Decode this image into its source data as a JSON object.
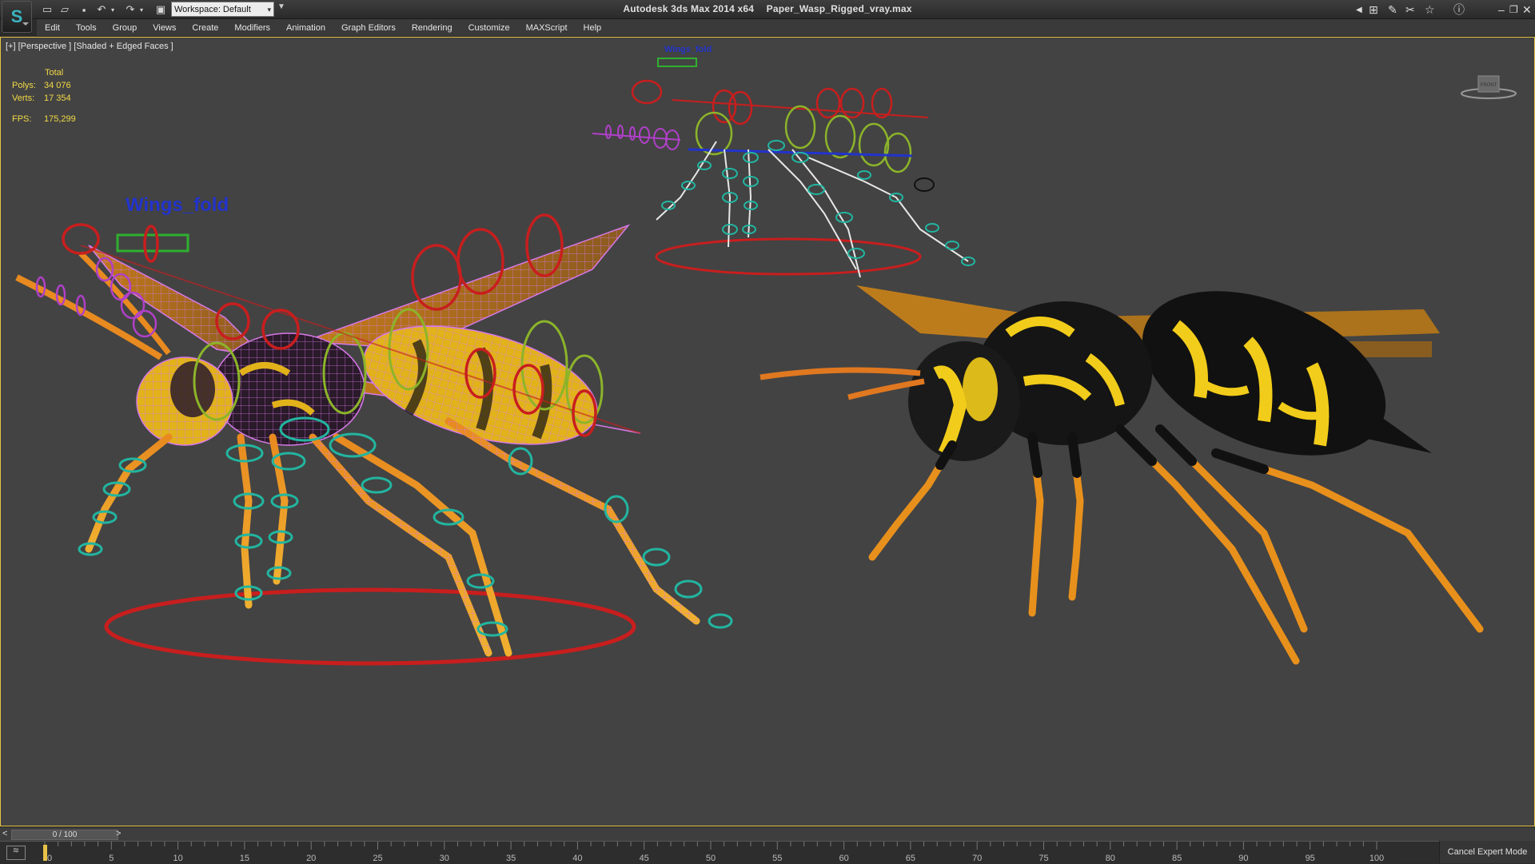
{
  "titlebar": {
    "app_title": "Autodesk 3ds Max  2014 x64",
    "file_name": "Paper_Wasp_Rigged_vray.max",
    "workspace_value": "Workspace: Default",
    "icons": [
      "new-file-icon",
      "open-file-icon",
      "save-icon",
      "undo-icon",
      "redo-icon",
      "project-folder-icon",
      "search-binoculars-icon",
      "tools-icon",
      "snap-icon",
      "star-icon",
      "help-icon",
      "minimize-icon",
      "restore-icon",
      "close-icon"
    ]
  },
  "menu": [
    "Edit",
    "Tools",
    "Group",
    "Views",
    "Create",
    "Modifiers",
    "Animation",
    "Graph Editors",
    "Rendering",
    "Customize",
    "MAXScript",
    "Help"
  ],
  "viewport": {
    "label": "[+] [Perspective ] [Shaded + Edged Faces ]",
    "stats": {
      "header": "Total",
      "polys_label": "Polys:",
      "polys_value": "34 076",
      "verts_label": "Verts:",
      "verts_value": "17 354",
      "fps_label": "FPS:",
      "fps_value": "175,299"
    },
    "rig_label_large": "Wings_fold",
    "rig_label_small": "Wings_fold",
    "viewcube_label": "FRONT"
  },
  "timeslider": {
    "value": "0 / 100",
    "prev": "<",
    "next": ">"
  },
  "timeline": {
    "ticks": [
      "0",
      "5",
      "10",
      "15",
      "20",
      "25",
      "30",
      "35",
      "40",
      "45",
      "50",
      "55",
      "60",
      "65",
      "70",
      "75",
      "80",
      "85",
      "90",
      "95",
      "100"
    ]
  },
  "status": {
    "cancel_expert_mode": "Cancel Expert Mode"
  },
  "colors": {
    "accent_yellow": "#f3da46",
    "viewport_bg": "#434343",
    "rig_red": "#c81e1e",
    "rig_green": "#8cb42a",
    "rig_cyan": "#22b5a0",
    "rig_purple": "#b040c8",
    "wireframe_pink": "#d878e8"
  }
}
